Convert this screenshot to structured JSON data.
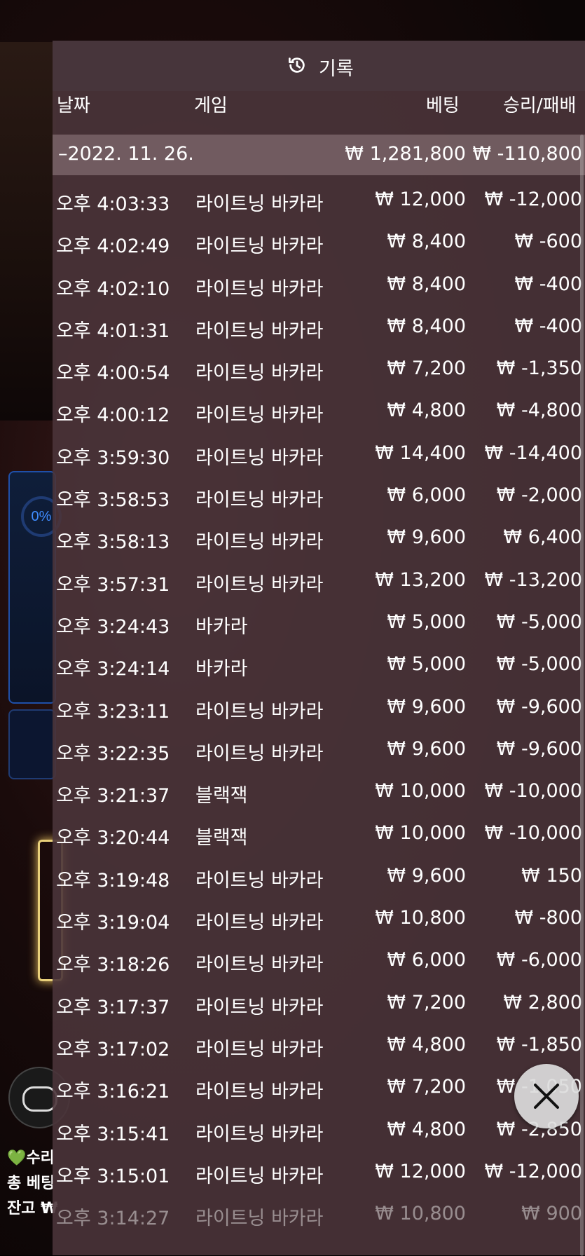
{
  "panel": {
    "title": "기록",
    "columns": {
      "date": "날짜",
      "game": "게임",
      "bet": "베팅",
      "win_loss": "승리/패배"
    },
    "day_summary": {
      "date": "–2022. 11. 26.",
      "bet": "₩ 1,281,800",
      "win_loss": "₩ -110,800"
    },
    "rows": [
      {
        "time": "오후 4:03:33",
        "game": "라이트닝 바카라",
        "bet": "₩ 12,000",
        "win_loss": "₩ -12,000"
      },
      {
        "time": "오후 4:02:49",
        "game": "라이트닝 바카라",
        "bet": "₩ 8,400",
        "win_loss": "₩ -600"
      },
      {
        "time": "오후 4:02:10",
        "game": "라이트닝 바카라",
        "bet": "₩ 8,400",
        "win_loss": "₩ -400"
      },
      {
        "time": "오후 4:01:31",
        "game": "라이트닝 바카라",
        "bet": "₩ 8,400",
        "win_loss": "₩ -400"
      },
      {
        "time": "오후 4:00:54",
        "game": "라이트닝 바카라",
        "bet": "₩ 7,200",
        "win_loss": "₩ -1,350"
      },
      {
        "time": "오후 4:00:12",
        "game": "라이트닝 바카라",
        "bet": "₩ 4,800",
        "win_loss": "₩ -4,800"
      },
      {
        "time": "오후 3:59:30",
        "game": "라이트닝 바카라",
        "bet": "₩ 14,400",
        "win_loss": "₩ -14,400"
      },
      {
        "time": "오후 3:58:53",
        "game": "라이트닝 바카라",
        "bet": "₩ 6,000",
        "win_loss": "₩ -2,000"
      },
      {
        "time": "오후 3:58:13",
        "game": "라이트닝 바카라",
        "bet": "₩ 9,600",
        "win_loss": "₩ 6,400"
      },
      {
        "time": "오후 3:57:31",
        "game": "라이트닝 바카라",
        "bet": "₩ 13,200",
        "win_loss": "₩ -13,200"
      },
      {
        "time": "오후 3:24:43",
        "game": "바카라",
        "bet": "₩ 5,000",
        "win_loss": "₩ -5,000"
      },
      {
        "time": "오후 3:24:14",
        "game": "바카라",
        "bet": "₩ 5,000",
        "win_loss": "₩ -5,000"
      },
      {
        "time": "오후 3:23:11",
        "game": "라이트닝 바카라",
        "bet": "₩ 9,600",
        "win_loss": "₩ -9,600"
      },
      {
        "time": "오후 3:22:35",
        "game": "라이트닝 바카라",
        "bet": "₩ 9,600",
        "win_loss": "₩ -9,600"
      },
      {
        "time": "오후 3:21:37",
        "game": "블랙잭",
        "bet": "₩ 10,000",
        "win_loss": "₩ -10,000"
      },
      {
        "time": "오후 3:20:44",
        "game": "블랙잭",
        "bet": "₩ 10,000",
        "win_loss": "₩ -10,000"
      },
      {
        "time": "오후 3:19:48",
        "game": "라이트닝 바카라",
        "bet": "₩ 9,600",
        "win_loss": "₩ 150"
      },
      {
        "time": "오후 3:19:04",
        "game": "라이트닝 바카라",
        "bet": "₩ 10,800",
        "win_loss": "₩ -800"
      },
      {
        "time": "오후 3:18:26",
        "game": "라이트닝 바카라",
        "bet": "₩ 6,000",
        "win_loss": "₩ -6,000"
      },
      {
        "time": "오후 3:17:37",
        "game": "라이트닝 바카라",
        "bet": "₩ 7,200",
        "win_loss": "₩ 2,800"
      },
      {
        "time": "오후 3:17:02",
        "game": "라이트닝 바카라",
        "bet": "₩ 4,800",
        "win_loss": "₩ -1,850"
      },
      {
        "time": "오후 3:16:21",
        "game": "라이트닝 바카라",
        "bet": "₩ 7,200",
        "win_loss": "₩ -1,050"
      },
      {
        "time": "오후 3:15:41",
        "game": "라이트닝 바카라",
        "bet": "₩ 4,800",
        "win_loss": "₩ -2,850"
      },
      {
        "time": "오후 3:15:01",
        "game": "라이트닝 바카라",
        "bet": "₩ 12,000",
        "win_loss": "₩ -12,000"
      },
      {
        "time": "오후 3:14:27",
        "game": "라이트닝 바카라",
        "bet": "₩ 10,800",
        "win_loss": "₩ 900"
      }
    ]
  },
  "background": {
    "progress_label": "0%",
    "chat_line": "💚수리",
    "total_bet_label": "총 베팅",
    "balance_label": "잔고 ₩"
  },
  "colors": {
    "accent_gold": "#f2c12e",
    "accent_blue": "#3f8cff"
  }
}
